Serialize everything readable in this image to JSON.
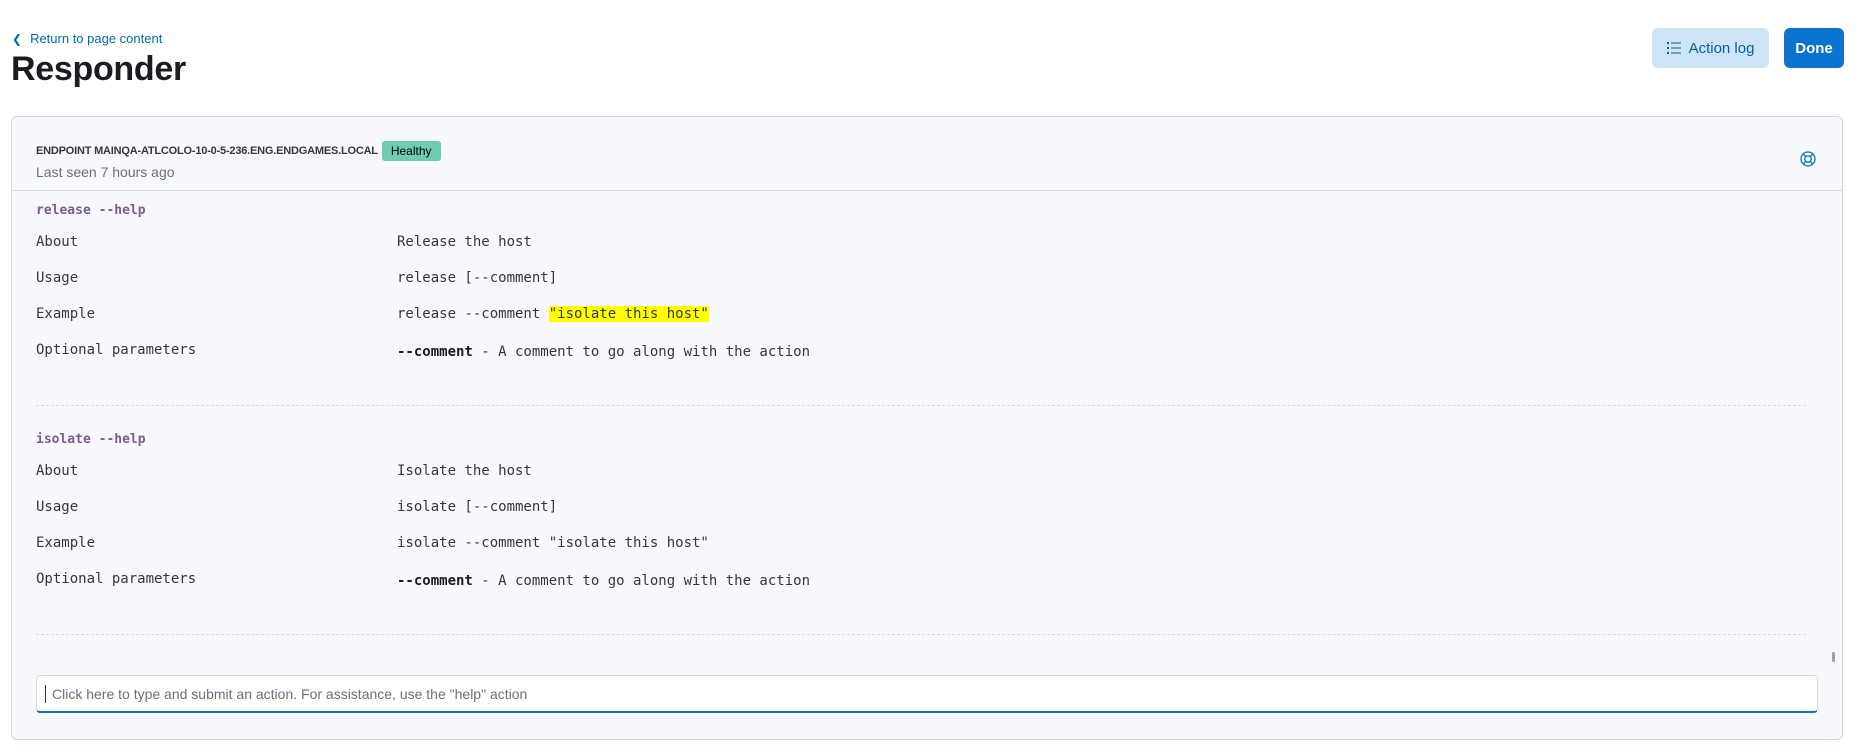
{
  "header": {
    "back_link": "Return to page content",
    "title": "Responder",
    "action_log_label": "Action log",
    "done_label": "Done"
  },
  "endpoint": {
    "name": "ENDPOINT MAINQA-ATLCOLO-10-0-5-236.ENG.ENDGAMES.LOCAL",
    "status": "Healthy",
    "status_color": "#6dccb1",
    "last_seen": "Last seen 7 hours ago"
  },
  "help_blocks": [
    {
      "command": "release --help",
      "rows": [
        {
          "label": "About",
          "value": "Release the host"
        },
        {
          "label": "Usage",
          "value": "release [--comment]"
        },
        {
          "label": "Example",
          "value_prefix": "release --comment ",
          "value_highlight": "\"isolate this host\""
        },
        {
          "label": "Optional parameters",
          "param": "--comment",
          "param_desc": " - A comment to go along with the action"
        }
      ]
    },
    {
      "command": "isolate --help",
      "rows": [
        {
          "label": "About",
          "value": "Isolate the host"
        },
        {
          "label": "Usage",
          "value": "isolate [--comment]"
        },
        {
          "label": "Example",
          "value": "isolate --comment \"isolate this host\""
        },
        {
          "label": "Optional parameters",
          "param": "--comment",
          "param_desc": " - A comment to go along with the action"
        }
      ]
    }
  ],
  "input": {
    "placeholder": "Click here to type and submit an action. For assistance, use the \"help\" action"
  },
  "colors": {
    "accent": "#0b74d0",
    "command_text": "#7f5a93",
    "highlight": "#ffff00"
  },
  "icons": [
    "chevron-left-icon",
    "list-icon",
    "help-lifebuoy-icon"
  ]
}
